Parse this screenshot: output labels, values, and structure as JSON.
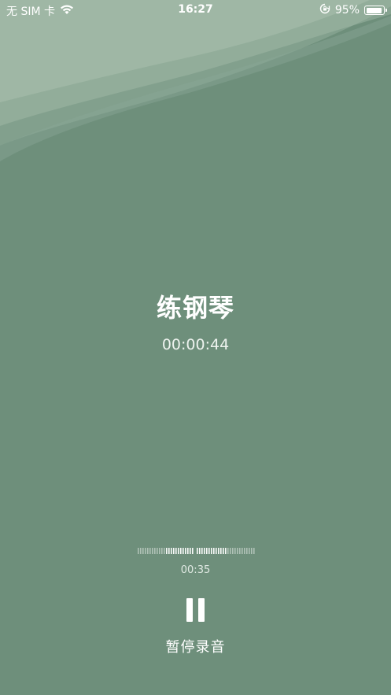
{
  "status_bar": {
    "carrier": "无 SIM 卡",
    "time": "16:27",
    "battery_percent_label": "95%",
    "battery_level": 0.95,
    "icons": [
      "wifi-icon",
      "orientation-lock-icon",
      "battery-icon"
    ]
  },
  "recording": {
    "title": "练钢琴",
    "elapsed": "00:00:44"
  },
  "playback": {
    "progress_time": "00:35"
  },
  "controls": {
    "pause_icon": "pause-icon",
    "pause_label": "暂停录音"
  },
  "colors": {
    "background": "#6e8f7b",
    "text": "#ffffff"
  }
}
